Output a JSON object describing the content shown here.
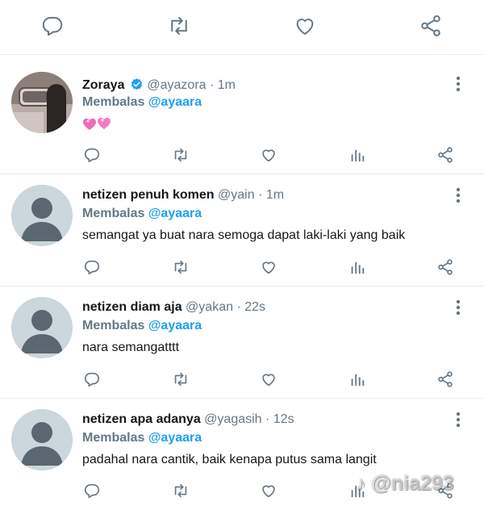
{
  "colors": {
    "link": "#1da1f2",
    "muted": "#657786",
    "border": "#e6ecf0",
    "icon": "#657786",
    "verified": "#1da1f2"
  },
  "top_actions": [
    {
      "name": "reply-icon"
    },
    {
      "name": "retweet-icon"
    },
    {
      "name": "like-icon"
    },
    {
      "name": "share-icon"
    }
  ],
  "tweets": [
    {
      "name": "Zoraya",
      "verified": true,
      "handle": "@ayazora",
      "sep": "·",
      "time": "1m",
      "reply_label": "Membalas",
      "reply_to": "@ayaara",
      "text": "",
      "emoji": "two-hearts-emoji",
      "avatar": "profile-photo"
    },
    {
      "name": "netizen penuh komen",
      "verified": false,
      "handle": "@yain",
      "sep": "·",
      "time": "1m",
      "reply_label": "Membalas",
      "reply_to": "@ayaara",
      "text": "semangat ya buat nara semoga dapat laki-laki yang baik",
      "avatar": "default-avatar"
    },
    {
      "name": "netizen diam aja",
      "verified": false,
      "handle": "@yakan",
      "sep": "·",
      "time": "22s",
      "reply_label": "Membalas",
      "reply_to": "@ayaara",
      "text": "nara semangatttt",
      "avatar": "default-avatar"
    },
    {
      "name": "netizen apa adanya",
      "verified": false,
      "handle": "@yagasih",
      "sep": "·",
      "time": "12s",
      "reply_label": "Membalas",
      "reply_to": "@ayaara",
      "text": "padahal nara cantik, baik kenapa putus sama langit",
      "avatar": "default-avatar"
    }
  ],
  "watermark": "@nia293"
}
